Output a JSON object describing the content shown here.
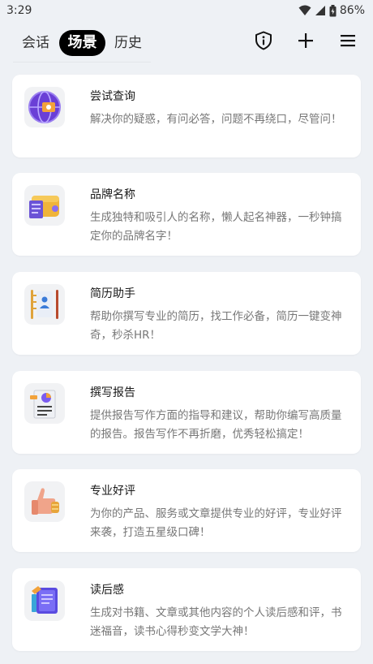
{
  "status": {
    "time": "3:29",
    "battery": "86%"
  },
  "tabs": [
    {
      "label": "会话"
    },
    {
      "label": "场景"
    },
    {
      "label": "历史"
    }
  ],
  "active_tab": "场景",
  "cards": [
    {
      "title": "尝试查询",
      "desc": "解决你的疑惑，有问必答，问题不再绕口，尽管问！",
      "icon": "globe-icon"
    },
    {
      "title": "品牌名称",
      "desc": "生成独特和吸引人的名称，懒人起名神器，一秒钟搞定你的品牌名字！",
      "icon": "wallet-icon"
    },
    {
      "title": "简历助手",
      "desc": "帮助你撰写专业的简历，找工作必备，简历一键变神奇，秒杀HR！",
      "icon": "resume-icon"
    },
    {
      "title": "撰写报告",
      "desc": "提供报告写作方面的指导和建议，帮助你编写高质量的报告。报告写作不再折磨，优秀轻松搞定！",
      "icon": "report-icon"
    },
    {
      "title": "专业好评",
      "desc": "为你的产品、服务或文章提供专业的好评，专业好评来袭，打造五星级口碑！",
      "icon": "thumbs-up-icon"
    },
    {
      "title": "读后感",
      "desc": "生成对书籍、文章或其他内容的个人读后感和评，书迷福音，读书心得秒变文学大神！",
      "icon": "book-icon"
    }
  ]
}
